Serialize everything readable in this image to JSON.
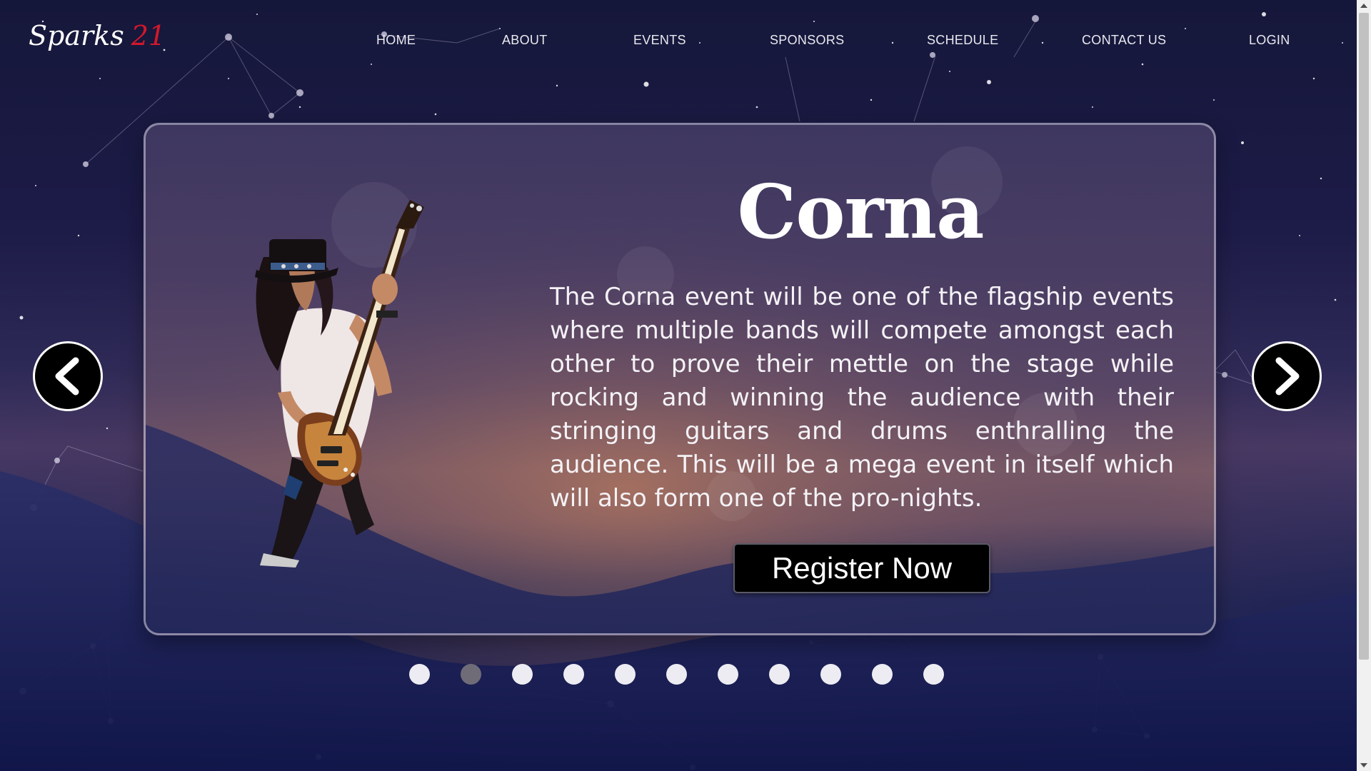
{
  "logo": {
    "text": "Sparks",
    "number": "21"
  },
  "nav": {
    "items": [
      {
        "label": "HOME"
      },
      {
        "label": "ABOUT"
      },
      {
        "label": "EVENTS"
      },
      {
        "label": "SPONSORS"
      },
      {
        "label": "SCHEDULE"
      },
      {
        "label": "CONTACT US"
      },
      {
        "label": "LOGIN"
      }
    ]
  },
  "event": {
    "title": "Corna",
    "description": "The Corna event will be one of the flagship events where multiple bands will compete amongst each other to prove their mettle on the stage while rocking and winning the audience with their stringing guitars and drums enthralling the audience. This will be a mega event in itself which will also form one of the pro-nights.",
    "register_label": "Register Now"
  },
  "carousel": {
    "slide_count": 11,
    "active_index": 1,
    "prev_icon": "chevron-left-icon",
    "next_icon": "chevron-right-icon"
  },
  "colors": {
    "accent_red": "#d3182b",
    "button_bg": "#000000",
    "dot_inactive": "#ececf2",
    "dot_active": "#6f6c78"
  }
}
